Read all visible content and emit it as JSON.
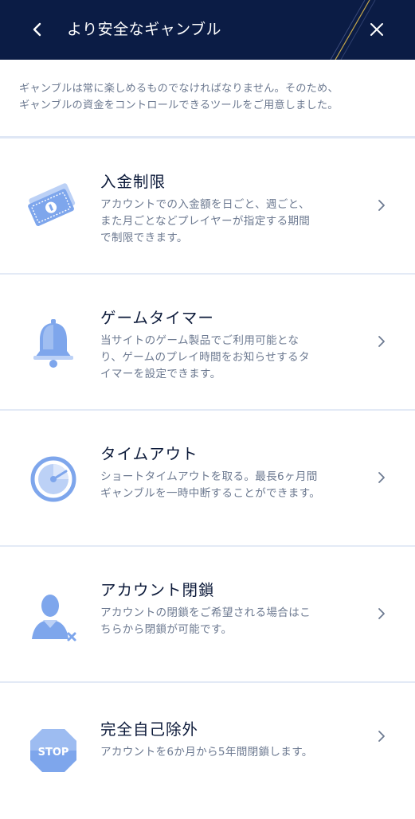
{
  "header": {
    "title": "より安全なギャンブル",
    "back_icon": "chevron-left-icon",
    "close_icon": "close-icon"
  },
  "intro": {
    "lines": [
      "ギャンブルは常に楽しめるものでなければなりません。そのため、",
      "ギャンブルの資金をコントロールできるツールをご用意しました。"
    ]
  },
  "tools": [
    {
      "title": "入金制限",
      "icon": "money-icon",
      "desc": [
        "アカウントでの入金額を日ごと、週ごと、",
        "また月ごとなどプレイヤーが指定する期間",
        "で制限できます。"
      ]
    },
    {
      "title": "ゲームタイマー",
      "icon": "bell-icon",
      "desc": [
        "当サイトのゲーム製品でご利用可能とな",
        "り、ゲームのプレイ時間をお知らせするタ",
        "イマーを設定できます。"
      ]
    },
    {
      "title": "タイムアウト",
      "icon": "timer-icon",
      "desc": [
        "ショートタイムアウトを取る。最長6ヶ月間",
        "ギャンブルを一時中断することができます。"
      ]
    },
    {
      "title": "アカウント閉鎖",
      "icon": "user-remove-icon",
      "desc": [
        "アカウントの閉鎖をご希望される場合はこ",
        "ちらから閉鎖が可能です。"
      ]
    },
    {
      "title": "完全自己除外",
      "icon": "stop-sign-icon",
      "stop_label": "STOP",
      "desc": [
        "アカウントを6か月から5年間閉鎖します。"
      ]
    }
  ],
  "colors": {
    "header_bg": "#0b1c45",
    "icon_blue": "#7ea6ec",
    "icon_light": "#bcd1f6",
    "text_dark": "#0c1a3a",
    "text_muted": "#6d7a91",
    "divider": "#e3eaf6"
  }
}
